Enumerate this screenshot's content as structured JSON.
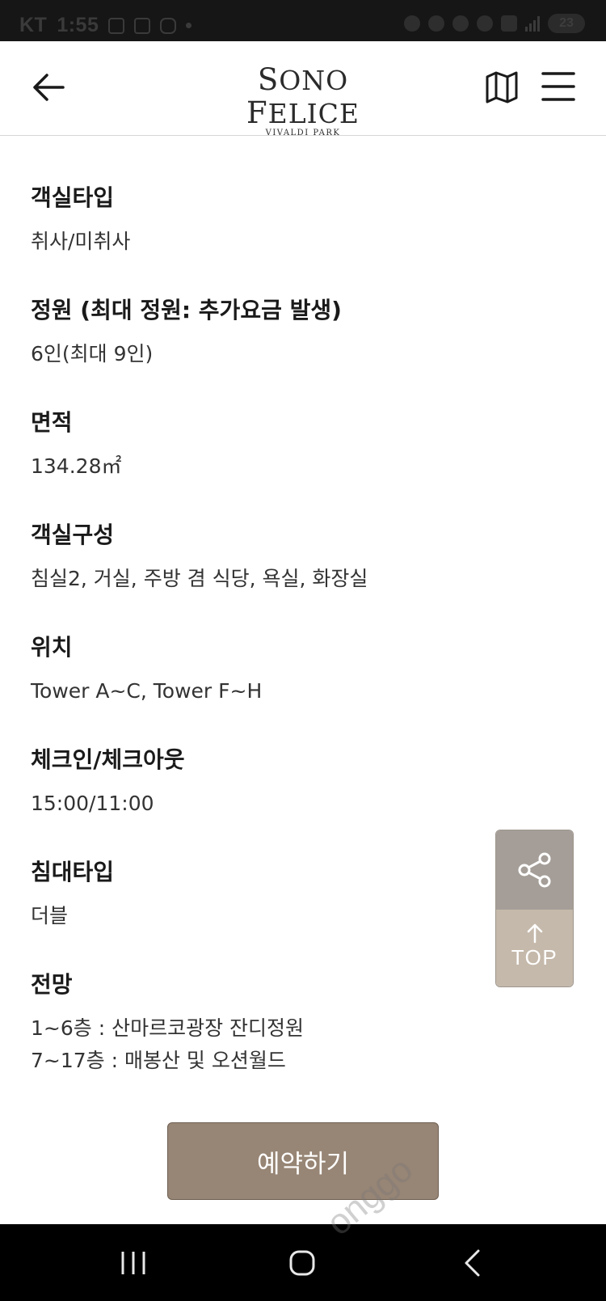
{
  "status_bar": {
    "carrier": "KT",
    "time": "1:55",
    "battery": "23"
  },
  "header": {
    "logo_main_s": "S",
    "logo_main_rest1": "ONO ",
    "logo_main_f": "F",
    "logo_main_rest2": "ELICE",
    "logo_sub": "VIVALDI PARK"
  },
  "specs": [
    {
      "label": "객실타입",
      "values": [
        "취사/미취사"
      ]
    },
    {
      "label": "정원 (최대 정원: 추가요금 발생)",
      "values": [
        "6인(최대 9인)"
      ]
    },
    {
      "label": "면적",
      "values": [
        "134.28㎡"
      ]
    },
    {
      "label": "객실구성",
      "values": [
        "침실2, 거실, 주방 겸 식당, 욕실, 화장실"
      ]
    },
    {
      "label": "위치",
      "values": [
        "Tower A~C, Tower F~H"
      ]
    },
    {
      "label": "체크인/체크아웃",
      "values": [
        "15:00/11:00"
      ]
    },
    {
      "label": "침대타입",
      "values": [
        "더블"
      ]
    },
    {
      "label": "전망",
      "values": [
        "1~6층 : 산마르코광장 잔디정원",
        "7~17층 : 매봉산 및 오션월드"
      ]
    }
  ],
  "float_buttons": {
    "top_label": "TOP"
  },
  "reserve": {
    "label": "예약하기"
  },
  "watermark": "onggo",
  "icons": {
    "back": "back-arrow-icon",
    "map": "map-icon",
    "menu": "hamburger-menu-icon",
    "share": "share-icon",
    "top_arrow": "arrow-up-icon"
  },
  "colors": {
    "reserve_button": "#978575",
    "share_button": "#a59e98",
    "top_button": "#c5b9ab"
  }
}
